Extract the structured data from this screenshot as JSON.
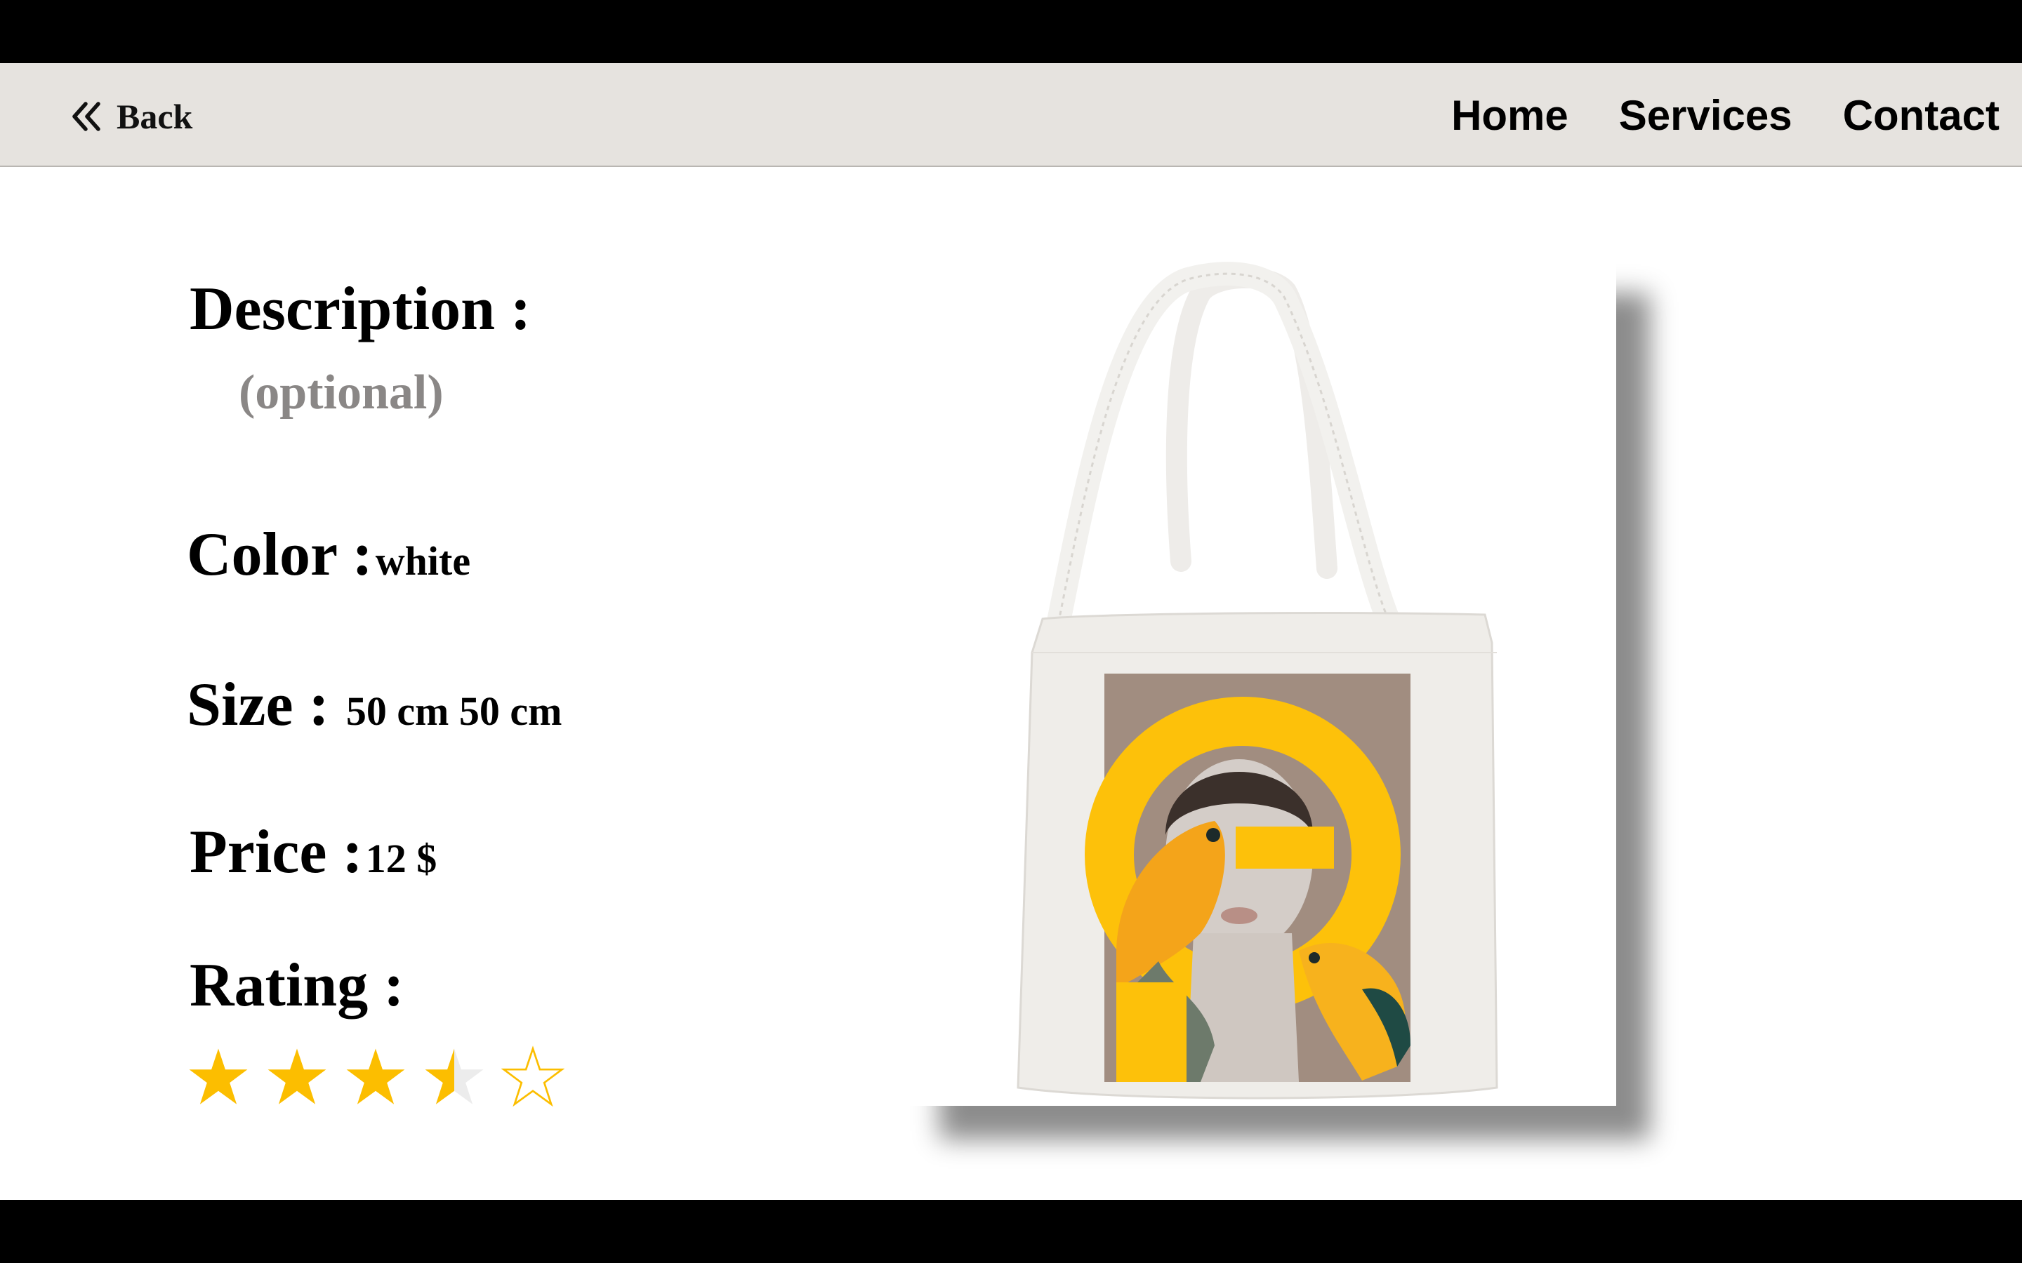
{
  "nav": {
    "back_label": "Back",
    "links": [
      "Home",
      "Services",
      "Contact"
    ]
  },
  "details": {
    "description_label": "Description :",
    "description_value": "(optional)",
    "color_label": "Color :",
    "color_value": "white",
    "size_label": "Size :",
    "size_value": "50 cm 50 cm",
    "price_label": "Price :",
    "price_value": "12 $",
    "rating_label": "Rating :",
    "rating_value": 3.5,
    "rating_max": 5
  },
  "product_image": {
    "subject": "white tote bag printed with collage of woman and orange parrots"
  },
  "colors": {
    "nav_bg": "#e6e3df",
    "star": "#fcbe00",
    "print_bg": "#a18d80",
    "print_accent": "#fdc10a"
  },
  "icons": {
    "back": "double-chevron-left-icon",
    "star": "star-icon"
  }
}
